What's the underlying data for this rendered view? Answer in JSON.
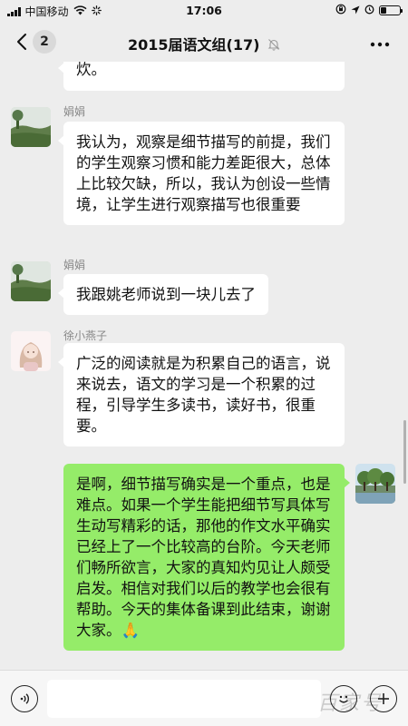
{
  "status_bar": {
    "carrier": "中国移动",
    "time": "17:06"
  },
  "nav": {
    "back_badge": "2",
    "title": "2015届语文组(17)"
  },
  "messages": [
    {
      "id": "m0",
      "direction": "in",
      "partial": true,
      "text": "炊。"
    },
    {
      "id": "m1",
      "direction": "in",
      "sender": "娟娟",
      "avatar": "landscape-avatar",
      "text": "我认为，观察是细节描写的前提，我们的学生观察习惯和能力差距很大，总体上比较欠缺，所以，我认为创设一些情境，让学生进行观察描写也很重要"
    },
    {
      "id": "m2",
      "direction": "in",
      "sender": "娟娟",
      "avatar": "landscape-avatar",
      "text": "我跟姚老师说到一块儿去了"
    },
    {
      "id": "m3",
      "direction": "in",
      "sender": "徐小燕子",
      "avatar": "girl-illustration-avatar",
      "text": "广泛的阅读就是为积累自己的语言，说来说去，语文的学习是一个积累的过程，引导学生多读书，读好书，很重要。"
    },
    {
      "id": "m4",
      "direction": "out",
      "avatar": "trees-avatar",
      "text": "是啊，细节描写确实是一个重点，也是难点。如果一个学生能把细节写具体写生动写精彩的话，那他的作文水平确实已经上了一个比较高的台阶。今天老师们畅所欲言，大家的真知灼见让人颇受启发。相信对我们以后的教学也会很有帮助。今天的集体备课到此结束，谢谢大家。",
      "emoji": "🙏"
    }
  ],
  "input_bar": {
    "watermark": "百家号"
  },
  "colors": {
    "background": "#ededed",
    "outgoing_bubble": "#95ec69",
    "incoming_bubble": "#ffffff"
  }
}
